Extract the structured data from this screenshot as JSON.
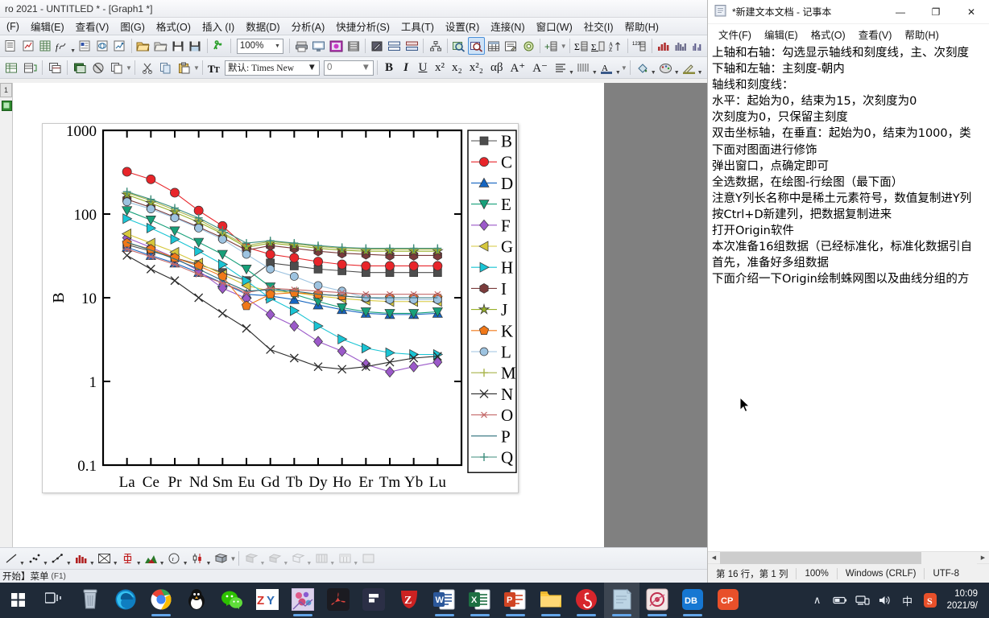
{
  "origin": {
    "title": "ro 2021 - UNTITLED * - [Graph1 *]",
    "menus": [
      {
        "label": "(F)",
        "key": ""
      },
      {
        "label": "编辑(E)"
      },
      {
        "label": "查看(V)"
      },
      {
        "label": "图(G)"
      },
      {
        "label": "格式(O)"
      },
      {
        "label": "插入 (I)"
      },
      {
        "label": "数据(D)"
      },
      {
        "label": "分析(A)"
      },
      {
        "label": "快捷分析(S)"
      },
      {
        "label": "工具(T)"
      },
      {
        "label": "设置(R)"
      },
      {
        "label": "连接(N)"
      },
      {
        "label": "窗口(W)"
      },
      {
        "label": "社交(I)"
      },
      {
        "label": "帮助(H)"
      }
    ],
    "toolbar": {
      "zoom_value": "100%",
      "font_value": "默认: Times New",
      "font_size_value": "0"
    },
    "rail_tab_label": "1",
    "status": {
      "text": "开始】菜单",
      "hint": "(F1)"
    }
  },
  "chart_data": {
    "type": "line",
    "title": "",
    "xlabel": "",
    "ylabel": "B",
    "ylim": [
      0.1,
      1000
    ],
    "yscale": "log",
    "yticks": [
      "1000",
      "100",
      "10",
      "1",
      "0.1"
    ],
    "grid": false,
    "legend_position": "right-outside",
    "categories": [
      "La",
      "Ce",
      "Pr",
      "Nd",
      "Sm",
      "Eu",
      "Gd",
      "Tb",
      "Dy",
      "Ho",
      "Er",
      "Tm",
      "Yb",
      "Lu"
    ],
    "series": [
      {
        "name": "B",
        "color": "#4d4d4d",
        "marker": "square",
        "values": [
          43,
          36,
          30,
          25,
          20,
          16,
          26,
          24,
          22,
          21,
          20,
          20,
          20,
          20
        ]
      },
      {
        "name": "C",
        "color": "#e8252a",
        "marker": "circle",
        "values": [
          320,
          260,
          180,
          110,
          72,
          40,
          33,
          30,
          27,
          25,
          24,
          24,
          24,
          24
        ]
      },
      {
        "name": "D",
        "color": "#1565c0",
        "marker": "triangle-up",
        "values": [
          40,
          32,
          26,
          20,
          15,
          11,
          10.5,
          9.5,
          8.2,
          7.2,
          6.5,
          6.3,
          6.3,
          6.5
        ]
      },
      {
        "name": "E",
        "color": "#17a07a",
        "marker": "triangle-down",
        "values": [
          110,
          85,
          63,
          46,
          33,
          22,
          13.5,
          11,
          9.0,
          7.6,
          6.8,
          6.5,
          6.5,
          6.8
        ]
      },
      {
        "name": "F",
        "color": "#9b59c9",
        "marker": "diamond",
        "values": [
          52,
          40,
          30,
          21,
          13,
          9.8,
          6.3,
          4.6,
          3.0,
          2.3,
          1.6,
          1.3,
          1.5,
          1.7
        ]
      },
      {
        "name": "G",
        "color": "#d6c73c",
        "marker": "triangle-left",
        "values": [
          58,
          45,
          35,
          26,
          19,
          14,
          12,
          11.5,
          10.5,
          9.8,
          9.3,
          9.0,
          9.0,
          9.0
        ]
      },
      {
        "name": "H",
        "color": "#19c4d4",
        "marker": "triangle-right",
        "values": [
          88,
          68,
          50,
          36,
          25,
          16,
          9.8,
          7.0,
          4.6,
          3.2,
          2.5,
          2.2,
          2.1,
          2.1
        ]
      },
      {
        "name": "I",
        "color": "#7a3b3b",
        "marker": "hexagon",
        "values": [
          150,
          120,
          92,
          70,
          52,
          37,
          42,
          39,
          36,
          34,
          33,
          32,
          32,
          32
        ]
      },
      {
        "name": "J",
        "color": "#98b028",
        "marker": "star",
        "values": [
          170,
          135,
          105,
          80,
          58,
          40,
          45,
          42,
          39,
          37,
          36,
          36,
          36,
          36
        ]
      },
      {
        "name": "K",
        "color": "#f07818",
        "marker": "pentagon",
        "values": [
          45,
          38,
          30,
          24,
          18,
          8.0,
          11,
          11.5,
          11,
          10.5,
          10,
          10,
          10,
          10
        ]
      },
      {
        "name": "L",
        "color": "#9dc3e0",
        "marker": "circle-small",
        "values": [
          140,
          115,
          90,
          68,
          50,
          33,
          22,
          18,
          14,
          12,
          10,
          9.5,
          9.5,
          9.5
        ]
      },
      {
        "name": "M",
        "color": "#a8b44a",
        "marker": "plus",
        "values": [
          180,
          145,
          112,
          86,
          60,
          42,
          47,
          44,
          41,
          39,
          38,
          38,
          38,
          38
        ]
      },
      {
        "name": "N",
        "color": "#2b2b2b",
        "marker": "cross",
        "values": [
          32,
          22,
          16,
          10,
          6.5,
          4.3,
          2.4,
          1.9,
          1.5,
          1.4,
          1.5,
          1.7,
          1.9,
          2.0
        ]
      },
      {
        "name": "O",
        "color": "#c46a6a",
        "marker": "asterisk",
        "values": [
          38,
          31,
          25,
          19,
          15,
          11.5,
          13,
          12.5,
          12,
          11.5,
          11,
          11,
          11,
          11
        ]
      },
      {
        "name": "P",
        "color": "#2a6e7a",
        "marker": "none",
        "values": [
          46,
          37,
          29,
          22,
          16,
          12,
          12.5,
          12,
          11,
          10.5,
          10,
          10,
          10,
          10
        ]
      },
      {
        "name": "Q",
        "color": "#3e8e7e",
        "marker": "plus-small",
        "values": [
          185,
          150,
          118,
          90,
          64,
          45,
          48,
          45,
          42,
          40,
          39,
          39,
          39,
          39
        ]
      }
    ]
  },
  "notepad": {
    "title": "*新建文本文档 - 记事本",
    "menus": [
      "文件(F)",
      "编辑(E)",
      "格式(O)",
      "查看(V)",
      "帮助(H)"
    ],
    "window_buttons": {
      "minimize": "—",
      "maximize": "❐",
      "close": "✕"
    },
    "lines": [
      "下面介绍一下Origin绘制蛛网图以及曲线分组的方",
      "首先，准备好多组数据",
      "本次准备16组数据（已经标准化，标准化数据引自",
      "打开Origin软件",
      "按Ctrl+D新建列，把数据复制进来",
      "注意Y列长名称中是稀土元素符号，数值复制进Y列",
      "全选数据，在绘图-行绘图（最下面）",
      "弹出窗口，点确定即可",
      "下面对图面进行修饰",
      "双击坐标轴，在垂直：起始为0，结束为1000，类",
      "次刻度为0，只保留主刻度",
      "水平：起始为0，结束为15，次刻度为0",
      "轴线和刻度线：",
      "下轴和左轴：主刻度-朝内",
      "上轴和右轴：勾选显示轴线和刻度线，主、次刻度"
    ],
    "status": {
      "position": "第 16 行，第 1 列",
      "zoom": "100%",
      "line_ending": "Windows (CRLF)",
      "encoding": "UTF-8"
    }
  },
  "taskbar": {
    "apps": [
      {
        "name": "task-view",
        "label": "",
        "color": "#2f3d4e"
      },
      {
        "name": "recycle-bin",
        "label": "",
        "color": "#8fa3b8"
      },
      {
        "name": "microsoft-edge",
        "label": "",
        "color": "#1f6fb5"
      },
      {
        "name": "google-chrome",
        "label": "",
        "color": "#f4b400"
      },
      {
        "name": "qq",
        "label": "",
        "color": "#ffffff"
      },
      {
        "name": "wechat",
        "label": "",
        "color": "#2dc100"
      },
      {
        "name": "zotero",
        "label": "ZY",
        "color": "#ffffff"
      },
      {
        "name": "drawing-app",
        "label": "",
        "color": "#e8c7e8"
      },
      {
        "name": "adobe-acrobat",
        "label": "",
        "color": "#1a1a1a"
      },
      {
        "name": "figma",
        "label": "",
        "color": "#2b2f46"
      },
      {
        "name": "zhihu",
        "label": "",
        "color": "#cc2222"
      },
      {
        "name": "microsoft-word",
        "label": "W",
        "color": "#2b579a"
      },
      {
        "name": "microsoft-excel",
        "label": "X",
        "color": "#1d6f42"
      },
      {
        "name": "microsoft-powerpoint",
        "label": "P",
        "color": "#d04423"
      },
      {
        "name": "file-explorer",
        "label": "",
        "color": "#ffc83d"
      },
      {
        "name": "netease-music",
        "label": "",
        "color": "#d7262c"
      },
      {
        "name": "notepad",
        "label": "",
        "color": "#a9c8dd"
      },
      {
        "name": "origin",
        "label": "",
        "color": "#e8d8d8"
      },
      {
        "name": "dingtalk",
        "label": "DB",
        "color": "#1677d2"
      },
      {
        "name": "cp-app",
        "label": "CP",
        "color": "#e8502a"
      }
    ],
    "tray": {
      "chevron": "∧",
      "battery": "battery-icon",
      "network": "network-icon",
      "volume": "volume-icon",
      "ime": "中",
      "sogou": "S"
    },
    "clock": {
      "time": "10:09",
      "date": "2021/9/"
    }
  }
}
